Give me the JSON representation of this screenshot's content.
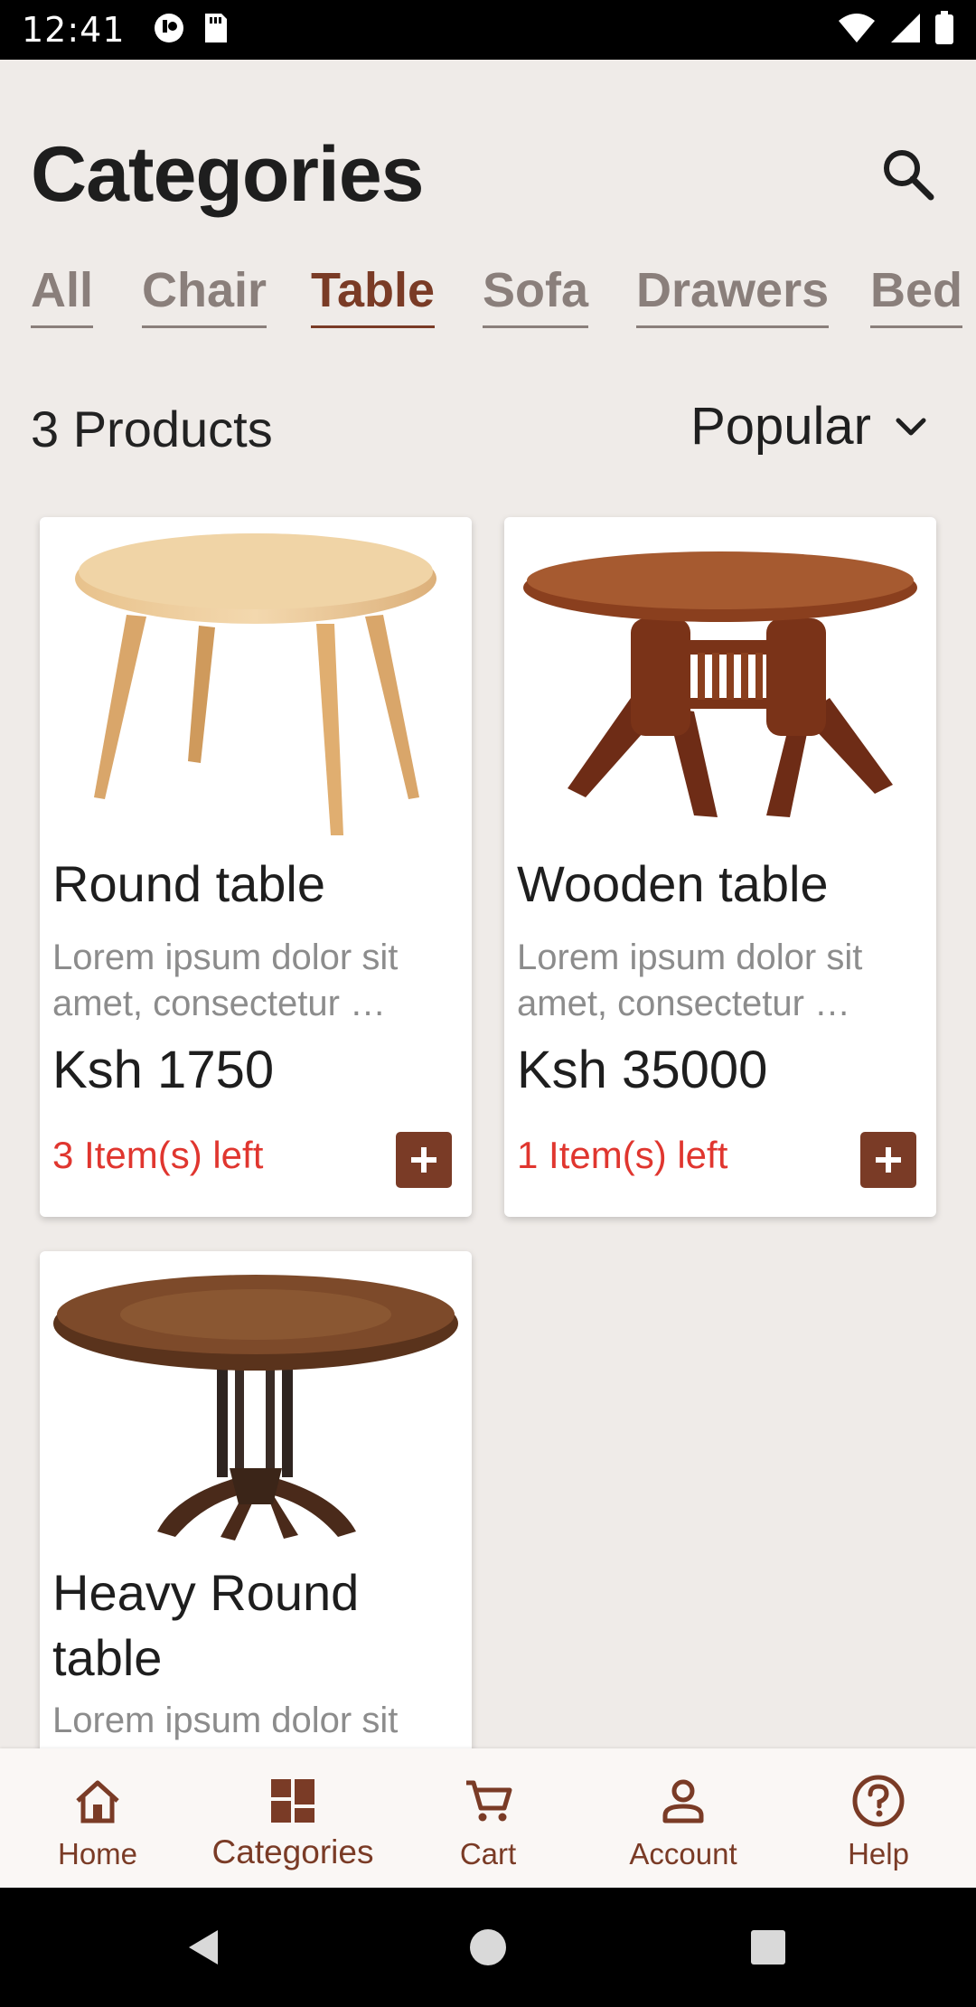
{
  "status_bar": {
    "time": "12:41"
  },
  "header": {
    "title": "Categories"
  },
  "tabs": [
    {
      "label": "All"
    },
    {
      "label": "Chair"
    },
    {
      "label": "Table"
    },
    {
      "label": "Sofa"
    },
    {
      "label": "Drawers"
    },
    {
      "label": "Bed"
    }
  ],
  "active_tab": "Table",
  "listing": {
    "count_label": "3 Products",
    "sort_label": "Popular"
  },
  "products": [
    {
      "title": "Round table",
      "description": "Lorem ipsum dolor sit amet, consectetur …",
      "price": "Ksh 1750",
      "stock": "3 Item(s) left"
    },
    {
      "title": "Wooden table",
      "description": "Lorem ipsum dolor sit amet, consectetur …",
      "price": "Ksh 35000",
      "stock": "1 Item(s) left"
    },
    {
      "title": "Heavy Round table",
      "description": "Lorem ipsum dolor sit"
    }
  ],
  "bottom_nav": [
    {
      "label": "Home",
      "icon": "home-icon"
    },
    {
      "label": "Categories",
      "icon": "grid-icon"
    },
    {
      "label": "Cart",
      "icon": "cart-icon"
    },
    {
      "label": "Account",
      "icon": "person-icon"
    },
    {
      "label": "Help",
      "icon": "help-icon"
    }
  ],
  "colors": {
    "accent": "#7a3b26",
    "stock_warning": "#e0362f",
    "background": "#efebe8"
  }
}
